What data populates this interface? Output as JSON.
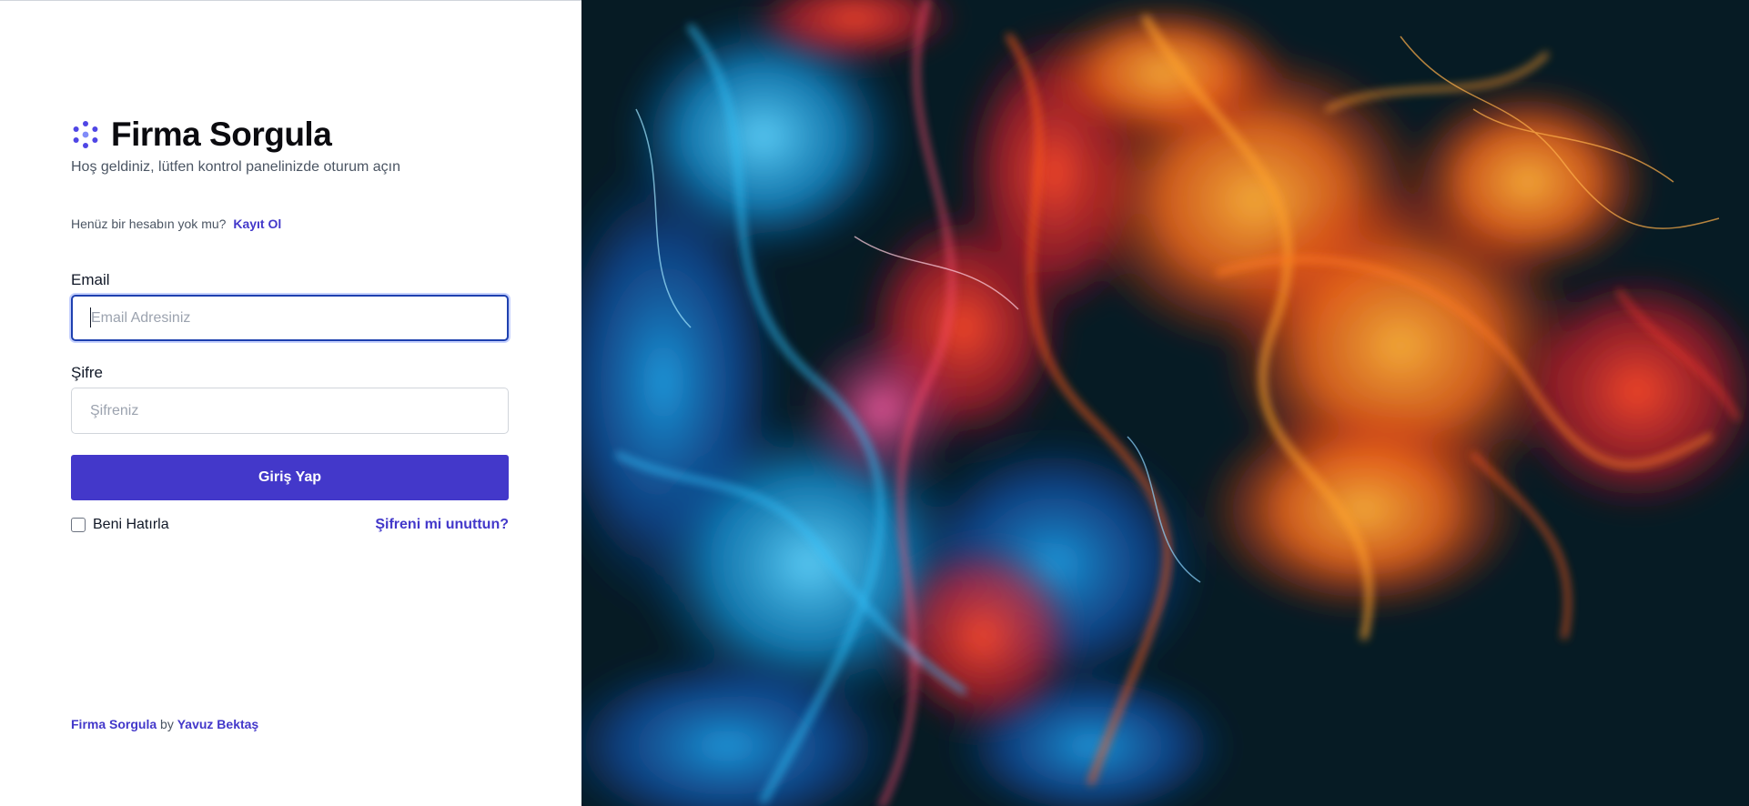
{
  "brand": {
    "title": "Firma Sorgula",
    "subtitle": "Hoş geldiniz, lütfen kontrol panelinizde oturum açın",
    "icon": "dots-circle-icon",
    "accent": "#4338ca"
  },
  "signup": {
    "prompt": "Henüz bir hesabın yok mu?",
    "link_label": "Kayıt Ol"
  },
  "form": {
    "email_label": "Email",
    "email_placeholder": "Email Adresiniz",
    "email_value": "",
    "password_label": "Şifre",
    "password_placeholder": "Şifreniz",
    "password_value": "",
    "submit_label": "Giriş Yap",
    "remember_label": "Beni Hatırla",
    "remember_checked": false,
    "forgot_label": "Şifreni mi unuttun?"
  },
  "footer": {
    "app_name": "Firma Sorgula",
    "by": "by",
    "author": "Yavuz Bektaş"
  },
  "hero": {
    "image": "abstract ink smoke artwork",
    "colors": [
      "#061b24",
      "#13a8e6",
      "#ff5a1a",
      "#ff8a1c",
      "#e8337a"
    ]
  }
}
